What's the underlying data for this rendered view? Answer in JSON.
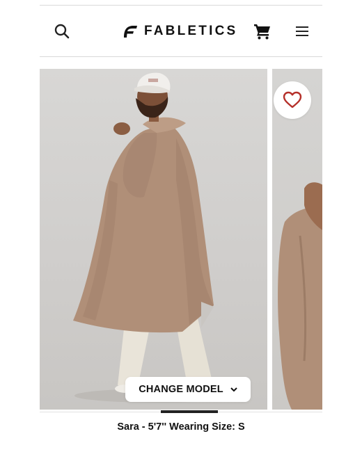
{
  "header": {
    "brand_name": "FABLETICS",
    "icons": {
      "search": "search-icon",
      "logo": "fabletics-logo-mark",
      "cart": "cart-icon",
      "menu": "hamburger-menu-icon"
    }
  },
  "product_gallery": {
    "favorite_icon": "heart-outline-icon",
    "change_model_label": "CHANGE MODEL",
    "change_model_icon": "chevron-down-icon",
    "model_info": "Sara - 5'7'' Wearing Size: S"
  },
  "colors": {
    "text": "#111111",
    "heart": "#b5302a",
    "coat": "#b08f78",
    "background": "#ffffff"
  }
}
